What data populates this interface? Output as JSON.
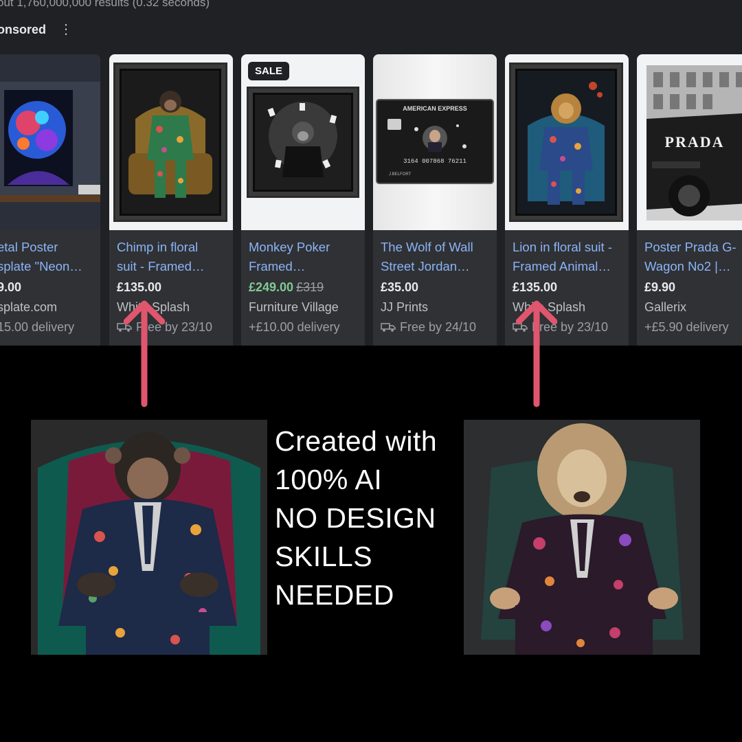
{
  "header": {
    "results_count": "out 1,760,000,000 results (0.32 seconds)",
    "sponsored_label": "onsored",
    "more_icon": "kebab-menu-icon"
  },
  "products": [
    {
      "title_line1": "etal Poster",
      "title_line2": "splate \"Neon…",
      "price": "9.00",
      "merchant": "splate.com",
      "delivery": "15.00 delivery"
    },
    {
      "title_line1": "Chimp in floral",
      "title_line2": "suit - Framed…",
      "price": "£135.00",
      "merchant": "White Splash",
      "delivery": "Free by 23/10"
    },
    {
      "title_line1": "Monkey Poker",
      "title_line2": "Framed…",
      "badge": "SALE",
      "sale_price": "£249.00",
      "old_price": "£319",
      "merchant": "Furniture Village",
      "delivery": "+£10.00 delivery"
    },
    {
      "title_line1": "The Wolf of Wall",
      "title_line2": "Street Jordan…",
      "price": "£35.00",
      "merchant": "JJ Prints",
      "delivery": "Free by 24/10"
    },
    {
      "title_line1": "Lion in floral suit -",
      "title_line2": "Framed Animal…",
      "price": "£135.00",
      "merchant": "White Splash",
      "delivery": "Free by 23/10"
    },
    {
      "title_line1": "Poster Prada G-",
      "title_line2": "Wagon No2 |…",
      "price": "£9.90",
      "merchant": "Gallerix",
      "delivery": "+£5.90 delivery"
    }
  ],
  "product_art_text": {
    "amex_brand": "AMERICAN EXPRESS",
    "amex_number": "3164 007868 76211",
    "amex_name": "J.BELFORT",
    "prada_brand": "PRADA"
  },
  "caption": {
    "line1": "Created with",
    "line2": "100% AI",
    "line3": "NO DESIGN",
    "line4": "SKILLS",
    "line5": "NEEDED"
  },
  "colors": {
    "arrow": "#e0566e",
    "link": "#8ab4f8",
    "sale_price": "#81c995"
  }
}
